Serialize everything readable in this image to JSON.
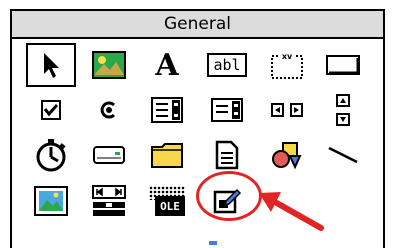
{
  "toolbox": {
    "title": "General",
    "tools": [
      {
        "row": 1,
        "col": 1,
        "icon": "pointer-icon",
        "selected": true
      },
      {
        "row": 1,
        "col": 2,
        "icon": "picture-box-icon"
      },
      {
        "row": 1,
        "col": 3,
        "icon": "label-icon",
        "glyph": "A"
      },
      {
        "row": 1,
        "col": 4,
        "icon": "textbox-icon",
        "glyph": "abl"
      },
      {
        "row": 1,
        "col": 5,
        "icon": "frame-icon",
        "glyph": "xv"
      },
      {
        "row": 1,
        "col": 6,
        "icon": "command-button-icon"
      },
      {
        "row": 2,
        "col": 1,
        "icon": "checkbox-icon"
      },
      {
        "row": 2,
        "col": 2,
        "icon": "option-button-icon"
      },
      {
        "row": 2,
        "col": 3,
        "icon": "combobox-icon"
      },
      {
        "row": 2,
        "col": 4,
        "icon": "listbox-icon"
      },
      {
        "row": 2,
        "col": 5,
        "icon": "hscrollbar-icon"
      },
      {
        "row": 2,
        "col": 6,
        "icon": "vscrollbar-icon"
      },
      {
        "row": 3,
        "col": 1,
        "icon": "timer-icon"
      },
      {
        "row": 3,
        "col": 2,
        "icon": "drive-listbox-icon"
      },
      {
        "row": 3,
        "col": 3,
        "icon": "directory-listbox-icon"
      },
      {
        "row": 3,
        "col": 4,
        "icon": "file-listbox-icon"
      },
      {
        "row": 3,
        "col": 5,
        "icon": "shape-icon"
      },
      {
        "row": 3,
        "col": 6,
        "icon": "line-icon"
      },
      {
        "row": 4,
        "col": 1,
        "icon": "image-icon"
      },
      {
        "row": 4,
        "col": 2,
        "icon": "data-control-icon"
      },
      {
        "row": 4,
        "col": 3,
        "icon": "ole-icon",
        "glyph": "OLE"
      },
      {
        "row": 4,
        "col": 4,
        "icon": "custom-control-icon",
        "highlighted": true
      }
    ],
    "colors": {
      "header_bg": "#dcdcdc",
      "highlight": "#e22424",
      "folder": "#f7d84a",
      "picture_sky": "#2aa84a"
    }
  }
}
